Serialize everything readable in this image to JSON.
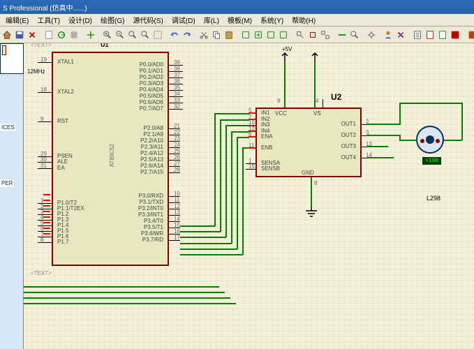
{
  "title": "S Professional (仿真中......)",
  "menu": [
    "编辑(E)",
    "工具(T)",
    "设计(D)",
    "绘图(G)",
    "源代码(S)",
    "调试(D)",
    "库(L)",
    "模板(M)",
    "系统(Y)",
    "帮助(H)"
  ],
  "sidebar": {
    "item1": "ICES",
    "item2": "PER"
  },
  "u1": {
    "ref": "U1",
    "part": "AT89C52",
    "osc": "12MHz",
    "left_pins": [
      {
        "pin": "19",
        "name": "XTAL1"
      },
      {
        "pin": "18",
        "name": "XTAL2"
      },
      {
        "pin": "9",
        "name": "RST"
      },
      {
        "pin": "29",
        "name": "PSEN"
      },
      {
        "pin": "30",
        "name": "ALE"
      },
      {
        "pin": "31",
        "name": "EA"
      },
      {
        "pin": "1",
        "name": "P1.0/T2"
      },
      {
        "pin": "2",
        "name": "P1.1/T2EX"
      },
      {
        "pin": "3",
        "name": "P1.2"
      },
      {
        "pin": "4",
        "name": "P1.3"
      },
      {
        "pin": "5",
        "name": "P1.4"
      },
      {
        "pin": "6",
        "name": "P1.5"
      },
      {
        "pin": "7",
        "name": "P1.6"
      },
      {
        "pin": "8",
        "name": "P1.7"
      }
    ],
    "right_pins_top": [
      {
        "pin": "39",
        "name": "P0.0/AD0"
      },
      {
        "pin": "38",
        "name": "P0.1/AD1"
      },
      {
        "pin": "37",
        "name": "P0.2/AD2"
      },
      {
        "pin": "36",
        "name": "P0.3/AD3"
      },
      {
        "pin": "35",
        "name": "P0.4/AD4"
      },
      {
        "pin": "34",
        "name": "P0.5/AD5"
      },
      {
        "pin": "33",
        "name": "P0.6/AD6"
      },
      {
        "pin": "32",
        "name": "P0.7/AD7"
      }
    ],
    "right_pins_mid": [
      {
        "pin": "21",
        "name": "P2.0/A8"
      },
      {
        "pin": "22",
        "name": "P2.1/A9"
      },
      {
        "pin": "23",
        "name": "P2.2/A10"
      },
      {
        "pin": "24",
        "name": "P2.3/A11"
      },
      {
        "pin": "25",
        "name": "P2.4/A12"
      },
      {
        "pin": "26",
        "name": "P2.5/A13"
      },
      {
        "pin": "27",
        "name": "P2.6/A14"
      },
      {
        "pin": "28",
        "name": "P2.7/A15"
      }
    ],
    "right_pins_bot": [
      {
        "pin": "10",
        "name": "P3.0/RXD"
      },
      {
        "pin": "11",
        "name": "P3.1/TXD"
      },
      {
        "pin": "12",
        "name": "P3.2/INT0"
      },
      {
        "pin": "13",
        "name": "P3.3/INT1"
      },
      {
        "pin": "14",
        "name": "P3.4/T0"
      },
      {
        "pin": "15",
        "name": "P3.5/T1"
      },
      {
        "pin": "16",
        "name": "P3.6/WR"
      },
      {
        "pin": "17",
        "name": "P3.7/RD"
      }
    ],
    "text_marker": "<TEXT>"
  },
  "u2": {
    "ref": "U2",
    "part": "L298",
    "left_pins": [
      {
        "pin": "5",
        "name": "IN1"
      },
      {
        "pin": "7",
        "name": "IN2"
      },
      {
        "pin": "10",
        "name": "IN3"
      },
      {
        "pin": "12",
        "name": "IN4"
      },
      {
        "pin": "6",
        "name": "ENA"
      },
      {
        "pin": "11",
        "name": "ENB"
      },
      {
        "pin": "1",
        "name": "SENSA"
      },
      {
        "pin": "15",
        "name": "SENSB"
      }
    ],
    "right_pins": [
      {
        "pin": "2",
        "name": "OUT1"
      },
      {
        "pin": "3",
        "name": "OUT2"
      },
      {
        "pin": "13",
        "name": "OUT3"
      },
      {
        "pin": "14",
        "name": "OUT4"
      }
    ],
    "top_pins": [
      {
        "pin": "9",
        "name": "VCC"
      },
      {
        "pin": "4",
        "name": "VS"
      }
    ],
    "bot_pins": [
      {
        "pin": "8",
        "name": "GND"
      }
    ]
  },
  "power_label": "+5V",
  "motor_value": "+198"
}
